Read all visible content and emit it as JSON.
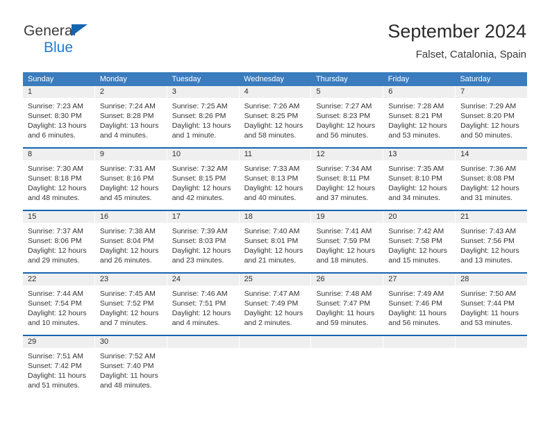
{
  "brand": {
    "name_part1": "General",
    "name_part2": "Blue",
    "triangle_color": "#1565b0"
  },
  "header": {
    "title": "September 2024",
    "subtitle": "Falset, Catalonia, Spain"
  },
  "theme": {
    "header_band": "#3a7cbe",
    "row_divider": "#1565b0",
    "daynum_band": "#efefef",
    "text": "#333333"
  },
  "weekdays": [
    "Sunday",
    "Monday",
    "Tuesday",
    "Wednesday",
    "Thursday",
    "Friday",
    "Saturday"
  ],
  "labels": {
    "sunrise_prefix": "Sunrise:",
    "sunset_prefix": "Sunset:",
    "daylight_prefix": "Daylight:"
  },
  "weeks": [
    [
      {
        "day": "1",
        "sunrise_line": "Sunrise: 7:23 AM",
        "sunset_line": "Sunset: 8:30 PM",
        "daylight_line1": "Daylight: 13 hours",
        "daylight_line2": "and 6 minutes."
      },
      {
        "day": "2",
        "sunrise_line": "Sunrise: 7:24 AM",
        "sunset_line": "Sunset: 8:28 PM",
        "daylight_line1": "Daylight: 13 hours",
        "daylight_line2": "and 4 minutes."
      },
      {
        "day": "3",
        "sunrise_line": "Sunrise: 7:25 AM",
        "sunset_line": "Sunset: 8:26 PM",
        "daylight_line1": "Daylight: 13 hours",
        "daylight_line2": "and 1 minute."
      },
      {
        "day": "4",
        "sunrise_line": "Sunrise: 7:26 AM",
        "sunset_line": "Sunset: 8:25 PM",
        "daylight_line1": "Daylight: 12 hours",
        "daylight_line2": "and 58 minutes."
      },
      {
        "day": "5",
        "sunrise_line": "Sunrise: 7:27 AM",
        "sunset_line": "Sunset: 8:23 PM",
        "daylight_line1": "Daylight: 12 hours",
        "daylight_line2": "and 56 minutes."
      },
      {
        "day": "6",
        "sunrise_line": "Sunrise: 7:28 AM",
        "sunset_line": "Sunset: 8:21 PM",
        "daylight_line1": "Daylight: 12 hours",
        "daylight_line2": "and 53 minutes."
      },
      {
        "day": "7",
        "sunrise_line": "Sunrise: 7:29 AM",
        "sunset_line": "Sunset: 8:20 PM",
        "daylight_line1": "Daylight: 12 hours",
        "daylight_line2": "and 50 minutes."
      }
    ],
    [
      {
        "day": "8",
        "sunrise_line": "Sunrise: 7:30 AM",
        "sunset_line": "Sunset: 8:18 PM",
        "daylight_line1": "Daylight: 12 hours",
        "daylight_line2": "and 48 minutes."
      },
      {
        "day": "9",
        "sunrise_line": "Sunrise: 7:31 AM",
        "sunset_line": "Sunset: 8:16 PM",
        "daylight_line1": "Daylight: 12 hours",
        "daylight_line2": "and 45 minutes."
      },
      {
        "day": "10",
        "sunrise_line": "Sunrise: 7:32 AM",
        "sunset_line": "Sunset: 8:15 PM",
        "daylight_line1": "Daylight: 12 hours",
        "daylight_line2": "and 42 minutes."
      },
      {
        "day": "11",
        "sunrise_line": "Sunrise: 7:33 AM",
        "sunset_line": "Sunset: 8:13 PM",
        "daylight_line1": "Daylight: 12 hours",
        "daylight_line2": "and 40 minutes."
      },
      {
        "day": "12",
        "sunrise_line": "Sunrise: 7:34 AM",
        "sunset_line": "Sunset: 8:11 PM",
        "daylight_line1": "Daylight: 12 hours",
        "daylight_line2": "and 37 minutes."
      },
      {
        "day": "13",
        "sunrise_line": "Sunrise: 7:35 AM",
        "sunset_line": "Sunset: 8:10 PM",
        "daylight_line1": "Daylight: 12 hours",
        "daylight_line2": "and 34 minutes."
      },
      {
        "day": "14",
        "sunrise_line": "Sunrise: 7:36 AM",
        "sunset_line": "Sunset: 8:08 PM",
        "daylight_line1": "Daylight: 12 hours",
        "daylight_line2": "and 31 minutes."
      }
    ],
    [
      {
        "day": "15",
        "sunrise_line": "Sunrise: 7:37 AM",
        "sunset_line": "Sunset: 8:06 PM",
        "daylight_line1": "Daylight: 12 hours",
        "daylight_line2": "and 29 minutes."
      },
      {
        "day": "16",
        "sunrise_line": "Sunrise: 7:38 AM",
        "sunset_line": "Sunset: 8:04 PM",
        "daylight_line1": "Daylight: 12 hours",
        "daylight_line2": "and 26 minutes."
      },
      {
        "day": "17",
        "sunrise_line": "Sunrise: 7:39 AM",
        "sunset_line": "Sunset: 8:03 PM",
        "daylight_line1": "Daylight: 12 hours",
        "daylight_line2": "and 23 minutes."
      },
      {
        "day": "18",
        "sunrise_line": "Sunrise: 7:40 AM",
        "sunset_line": "Sunset: 8:01 PM",
        "daylight_line1": "Daylight: 12 hours",
        "daylight_line2": "and 21 minutes."
      },
      {
        "day": "19",
        "sunrise_line": "Sunrise: 7:41 AM",
        "sunset_line": "Sunset: 7:59 PM",
        "daylight_line1": "Daylight: 12 hours",
        "daylight_line2": "and 18 minutes."
      },
      {
        "day": "20",
        "sunrise_line": "Sunrise: 7:42 AM",
        "sunset_line": "Sunset: 7:58 PM",
        "daylight_line1": "Daylight: 12 hours",
        "daylight_line2": "and 15 minutes."
      },
      {
        "day": "21",
        "sunrise_line": "Sunrise: 7:43 AM",
        "sunset_line": "Sunset: 7:56 PM",
        "daylight_line1": "Daylight: 12 hours",
        "daylight_line2": "and 13 minutes."
      }
    ],
    [
      {
        "day": "22",
        "sunrise_line": "Sunrise: 7:44 AM",
        "sunset_line": "Sunset: 7:54 PM",
        "daylight_line1": "Daylight: 12 hours",
        "daylight_line2": "and 10 minutes."
      },
      {
        "day": "23",
        "sunrise_line": "Sunrise: 7:45 AM",
        "sunset_line": "Sunset: 7:52 PM",
        "daylight_line1": "Daylight: 12 hours",
        "daylight_line2": "and 7 minutes."
      },
      {
        "day": "24",
        "sunrise_line": "Sunrise: 7:46 AM",
        "sunset_line": "Sunset: 7:51 PM",
        "daylight_line1": "Daylight: 12 hours",
        "daylight_line2": "and 4 minutes."
      },
      {
        "day": "25",
        "sunrise_line": "Sunrise: 7:47 AM",
        "sunset_line": "Sunset: 7:49 PM",
        "daylight_line1": "Daylight: 12 hours",
        "daylight_line2": "and 2 minutes."
      },
      {
        "day": "26",
        "sunrise_line": "Sunrise: 7:48 AM",
        "sunset_line": "Sunset: 7:47 PM",
        "daylight_line1": "Daylight: 11 hours",
        "daylight_line2": "and 59 minutes."
      },
      {
        "day": "27",
        "sunrise_line": "Sunrise: 7:49 AM",
        "sunset_line": "Sunset: 7:46 PM",
        "daylight_line1": "Daylight: 11 hours",
        "daylight_line2": "and 56 minutes."
      },
      {
        "day": "28",
        "sunrise_line": "Sunrise: 7:50 AM",
        "sunset_line": "Sunset: 7:44 PM",
        "daylight_line1": "Daylight: 11 hours",
        "daylight_line2": "and 53 minutes."
      }
    ],
    [
      {
        "day": "29",
        "sunrise_line": "Sunrise: 7:51 AM",
        "sunset_line": "Sunset: 7:42 PM",
        "daylight_line1": "Daylight: 11 hours",
        "daylight_line2": "and 51 minutes."
      },
      {
        "day": "30",
        "sunrise_line": "Sunrise: 7:52 AM",
        "sunset_line": "Sunset: 7:40 PM",
        "daylight_line1": "Daylight: 11 hours",
        "daylight_line2": "and 48 minutes."
      },
      {
        "day": "",
        "sunrise_line": "",
        "sunset_line": "",
        "daylight_line1": "",
        "daylight_line2": ""
      },
      {
        "day": "",
        "sunrise_line": "",
        "sunset_line": "",
        "daylight_line1": "",
        "daylight_line2": ""
      },
      {
        "day": "",
        "sunrise_line": "",
        "sunset_line": "",
        "daylight_line1": "",
        "daylight_line2": ""
      },
      {
        "day": "",
        "sunrise_line": "",
        "sunset_line": "",
        "daylight_line1": "",
        "daylight_line2": ""
      },
      {
        "day": "",
        "sunrise_line": "",
        "sunset_line": "",
        "daylight_line1": "",
        "daylight_line2": ""
      }
    ]
  ]
}
